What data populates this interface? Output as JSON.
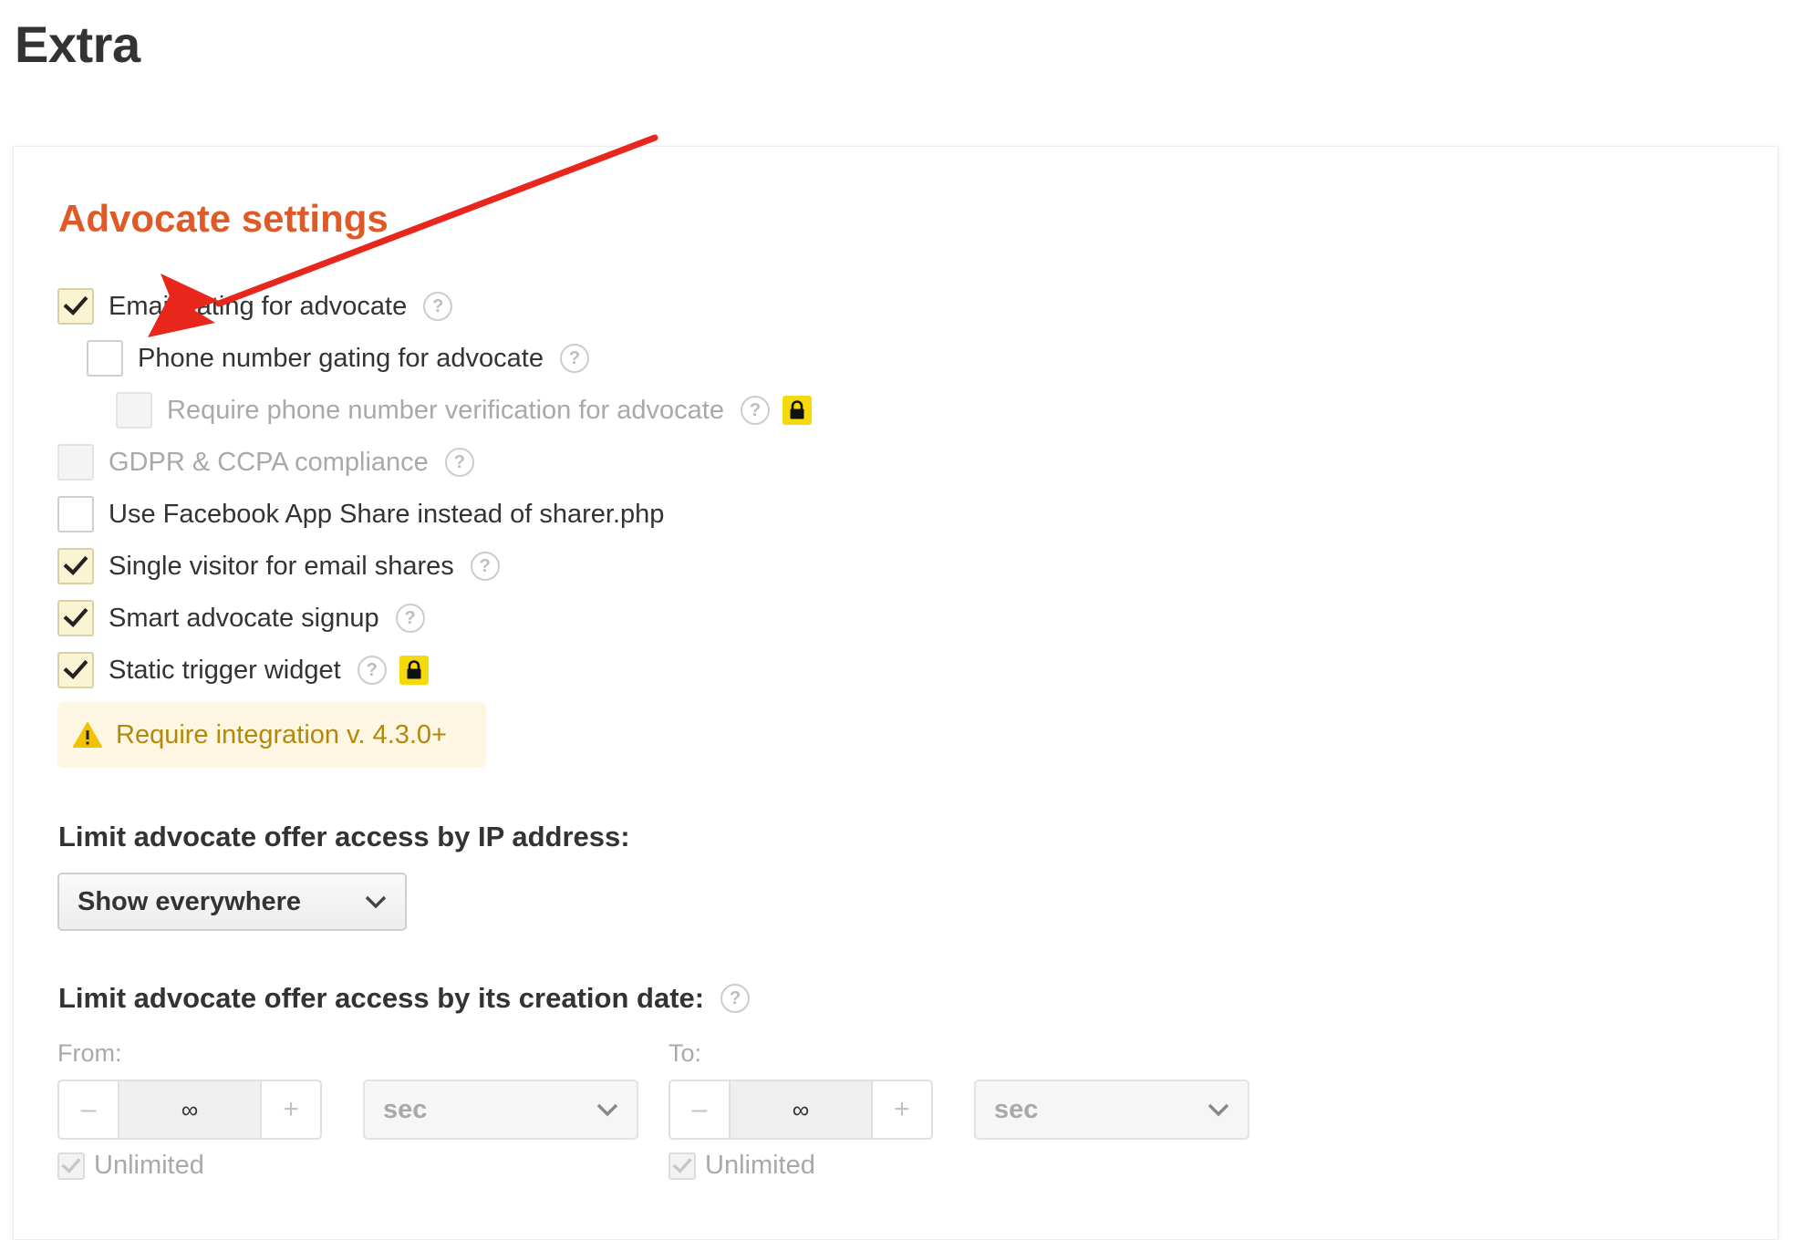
{
  "page": {
    "title": "Extra"
  },
  "advocate": {
    "title": "Advocate settings",
    "options": [
      {
        "label": "Email gating for advocate",
        "checked": true,
        "disabled": false,
        "help": true,
        "locked": false
      },
      {
        "label": "Phone number gating for advocate",
        "checked": false,
        "disabled": false,
        "help": true,
        "locked": false
      },
      {
        "label": "Require phone number verification for advocate",
        "checked": false,
        "disabled": true,
        "help": true,
        "locked": true
      },
      {
        "label": "GDPR & CCPA compliance",
        "checked": false,
        "disabled": true,
        "help": true,
        "locked": false
      },
      {
        "label": "Use Facebook App Share instead of sharer.php",
        "checked": false,
        "disabled": false,
        "help": false,
        "locked": false
      },
      {
        "label": "Single visitor for email shares",
        "checked": true,
        "disabled": false,
        "help": true,
        "locked": false
      },
      {
        "label": "Smart advocate signup",
        "checked": true,
        "disabled": false,
        "help": true,
        "locked": false
      },
      {
        "label": "Static trigger widget",
        "checked": true,
        "disabled": false,
        "help": true,
        "locked": true
      }
    ],
    "help_glyph": "?",
    "warning": "Require integration v. 4.3.0+"
  },
  "ip_limit": {
    "heading": "Limit advocate offer access by IP address:",
    "selected": "Show everywhere"
  },
  "date_limit": {
    "heading": "Limit advocate offer access by its creation date:",
    "from": {
      "label": "From:",
      "minus": "–",
      "value": "∞",
      "plus": "+",
      "unit": "sec",
      "unlimited_label": "Unlimited",
      "unlimited_checked": true
    },
    "to": {
      "label": "To:",
      "minus": "–",
      "value": "∞",
      "plus": "+",
      "unit": "sec",
      "unlimited_label": "Unlimited",
      "unlimited_checked": true
    }
  },
  "colors": {
    "accent": "#e05a28",
    "checked_bg": "#fbf4d3",
    "warning_text": "#b3890a",
    "warning_bg": "#fdf6e3",
    "lock_bg": "#f5d90a",
    "annotation_arrow": "#e8261c"
  },
  "icons": {
    "check": "check-icon",
    "help": "help-icon",
    "lock": "lock-icon",
    "warning": "warning-icon",
    "chevron": "chevron-down-icon",
    "annotation": "annotation-arrow"
  }
}
